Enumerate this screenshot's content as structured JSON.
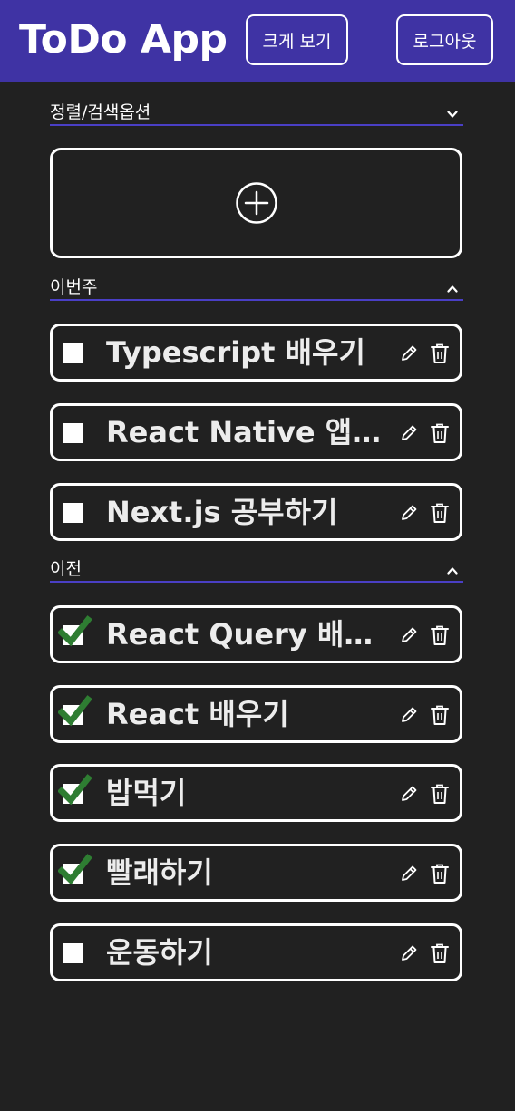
{
  "header": {
    "title": "ToDo App",
    "view_large_label": "크게 보기",
    "logout_label": "로그아웃"
  },
  "options": {
    "label": "정렬/검색옵션",
    "icon": "chevron-down-icon"
  },
  "add": {
    "icon": "plus-circle-icon"
  },
  "sections": [
    {
      "label": "이번주",
      "icon": "chevron-up-icon",
      "items": [
        {
          "text": "Typescript 배우기",
          "done": false
        },
        {
          "text": "React Native 앱 만들기",
          "done": false
        },
        {
          "text": "Next.js 공부하기",
          "done": false
        }
      ]
    },
    {
      "label": "이전",
      "icon": "chevron-up-icon",
      "items": [
        {
          "text": "React Query 배우기",
          "done": true
        },
        {
          "text": "React 배우기",
          "done": true
        },
        {
          "text": "밥먹기",
          "done": true
        },
        {
          "text": "빨래하기",
          "done": true
        },
        {
          "text": "운동하기",
          "done": false
        }
      ]
    }
  ],
  "colors": {
    "background": "#212121",
    "header": "#3f33a4",
    "divider": "#4a3fc5",
    "check": "#2e7d32"
  }
}
